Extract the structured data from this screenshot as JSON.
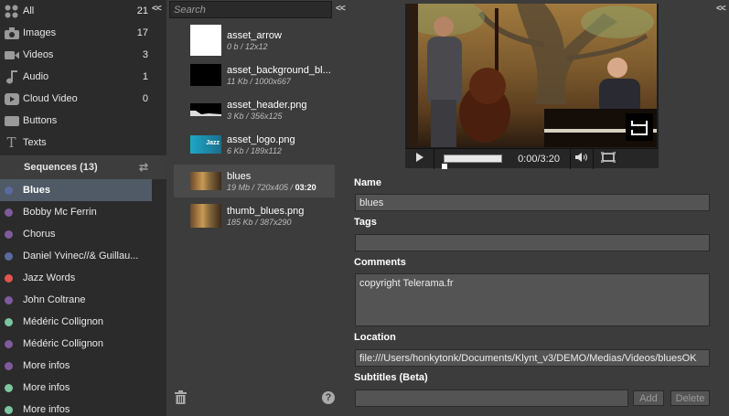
{
  "sidebar": {
    "collapse_label": "<<",
    "categories": [
      {
        "label": "All",
        "count": "21",
        "icon": "grid-icon"
      },
      {
        "label": "Images",
        "count": "17",
        "icon": "camera-icon"
      },
      {
        "label": "Videos",
        "count": "3",
        "icon": "video-camera-icon"
      },
      {
        "label": "Audio",
        "count": "1",
        "icon": "music-note-icon"
      },
      {
        "label": "Cloud Video",
        "count": "0",
        "icon": "play-icon"
      },
      {
        "label": "Buttons",
        "count": "",
        "icon": "button-icon"
      },
      {
        "label": "Texts",
        "count": "",
        "icon": "text-icon"
      }
    ],
    "sequences_header": "Sequences (13)",
    "sequences": [
      {
        "label": "Blues",
        "color": "#5a6aa0",
        "selected": true
      },
      {
        "label": "Bobby Mc Ferrin",
        "color": "#7f5a9c"
      },
      {
        "label": "Chorus",
        "color": "#7f5a9c"
      },
      {
        "label": "Daniel Yvinec//& Guillau...",
        "color": "#5a6aa0"
      },
      {
        "label": "Jazz Words",
        "color": "#e25450"
      },
      {
        "label": "John Coltrane",
        "color": "#7f5a9c"
      },
      {
        "label": "Médéric Collignon",
        "color": "#7bc6a0"
      },
      {
        "label": "Médéric Collignon",
        "color": "#7f5a9c"
      },
      {
        "label": "More infos",
        "color": "#7f5a9c"
      },
      {
        "label": "More infos",
        "color": "#7bc6a0"
      },
      {
        "label": "More infos",
        "color": "#7bc6a0"
      }
    ]
  },
  "assets": {
    "collapse_label": "<<",
    "search_placeholder": "Search",
    "items": [
      {
        "name": "asset_arrow",
        "meta": "0 b  /  12x12",
        "duration": "",
        "thumb": "white"
      },
      {
        "name": "asset_background_bl...",
        "meta": "11 Kb  /  1000x667",
        "duration": "",
        "thumb": "black"
      },
      {
        "name": "asset_header.png",
        "meta": "3 Kb  /  356x125",
        "duration": "",
        "thumb": "header"
      },
      {
        "name": "asset_logo.png",
        "meta": "6 Kb  /  189x112",
        "duration": "",
        "thumb": "logo"
      },
      {
        "name": "blues",
        "meta": "19 Mb  /  720x405  / ",
        "duration": "03:20",
        "thumb": "photo",
        "selected": true
      },
      {
        "name": "thumb_blues.png",
        "meta": "185 Kb  /  387x290",
        "duration": "",
        "thumb": "photo"
      }
    ],
    "logo_thumb_text": "Jazz"
  },
  "detail": {
    "collapse_label": "<<",
    "player": {
      "time": "0:00/3:20",
      "progress": 0
    },
    "name_label": "Name",
    "name_value": "blues",
    "tags_label": "Tags",
    "tags_value": "",
    "comments_label": "Comments",
    "comments_value": "copyright Telerama.fr",
    "location_label": "Location",
    "location_value": "file:///Users/honkytonk/Documents/Klynt_v3/DEMO/Medias/Videos/bluesOK",
    "subtitles_label": "Subtitles (Beta)",
    "subtitles_value": "",
    "add_label": "Add",
    "delete_label": "Delete"
  }
}
